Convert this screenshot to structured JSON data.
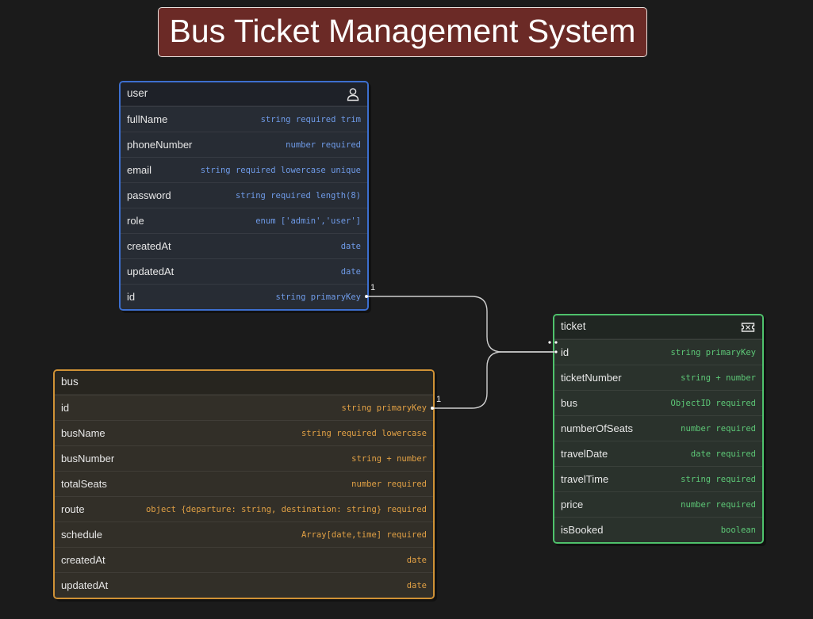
{
  "title": "Bus Ticket Management System",
  "colors": {
    "title_bg": "#6b2a26",
    "user_accent": "#3d6fcf",
    "bus_accent": "#d09236",
    "ticket_accent": "#4fc26c",
    "connector": "#cfcfcf"
  },
  "tables": {
    "user": {
      "name": "user",
      "icon": "user-icon",
      "fields": [
        {
          "name": "fullName",
          "type": "string required trim"
        },
        {
          "name": "phoneNumber",
          "type": "number required"
        },
        {
          "name": "email",
          "type": "string required lowercase unique"
        },
        {
          "name": "password",
          "type": "string required length(8)"
        },
        {
          "name": "role",
          "type": "enum ['admin','user']"
        },
        {
          "name": "createdAt",
          "type": "date"
        },
        {
          "name": "updatedAt",
          "type": "date"
        },
        {
          "name": "id",
          "type": "string primaryKey"
        }
      ]
    },
    "bus": {
      "name": "bus",
      "fields": [
        {
          "name": "id",
          "type": "string primaryKey"
        },
        {
          "name": "busName",
          "type": "string required lowercase"
        },
        {
          "name": "busNumber",
          "type": "string + number"
        },
        {
          "name": "totalSeats",
          "type": "number required"
        },
        {
          "name": "route",
          "type": "object {departure: string, destination: string} required"
        },
        {
          "name": "schedule",
          "type": "Array[date,time] required"
        },
        {
          "name": "createdAt",
          "type": "date"
        },
        {
          "name": "updatedAt",
          "type": "date"
        }
      ]
    },
    "ticket": {
      "name": "ticket",
      "icon": "ticket-icon",
      "fields": [
        {
          "name": "id",
          "type": "string primaryKey"
        },
        {
          "name": "ticketNumber",
          "type": "string + number"
        },
        {
          "name": "bus",
          "type": "ObjectID required"
        },
        {
          "name": "numberOfSeats",
          "type": "number required"
        },
        {
          "name": "travelDate",
          "type": "date required"
        },
        {
          "name": "travelTime",
          "type": "string required"
        },
        {
          "name": "price",
          "type": "number required"
        },
        {
          "name": "isBooked",
          "type": "boolean"
        }
      ]
    }
  },
  "relations": [
    {
      "from": "user.id",
      "to": "ticket.id",
      "from_cardinality": "1"
    },
    {
      "from": "bus.id",
      "to": "ticket.id",
      "from_cardinality": "1"
    }
  ]
}
